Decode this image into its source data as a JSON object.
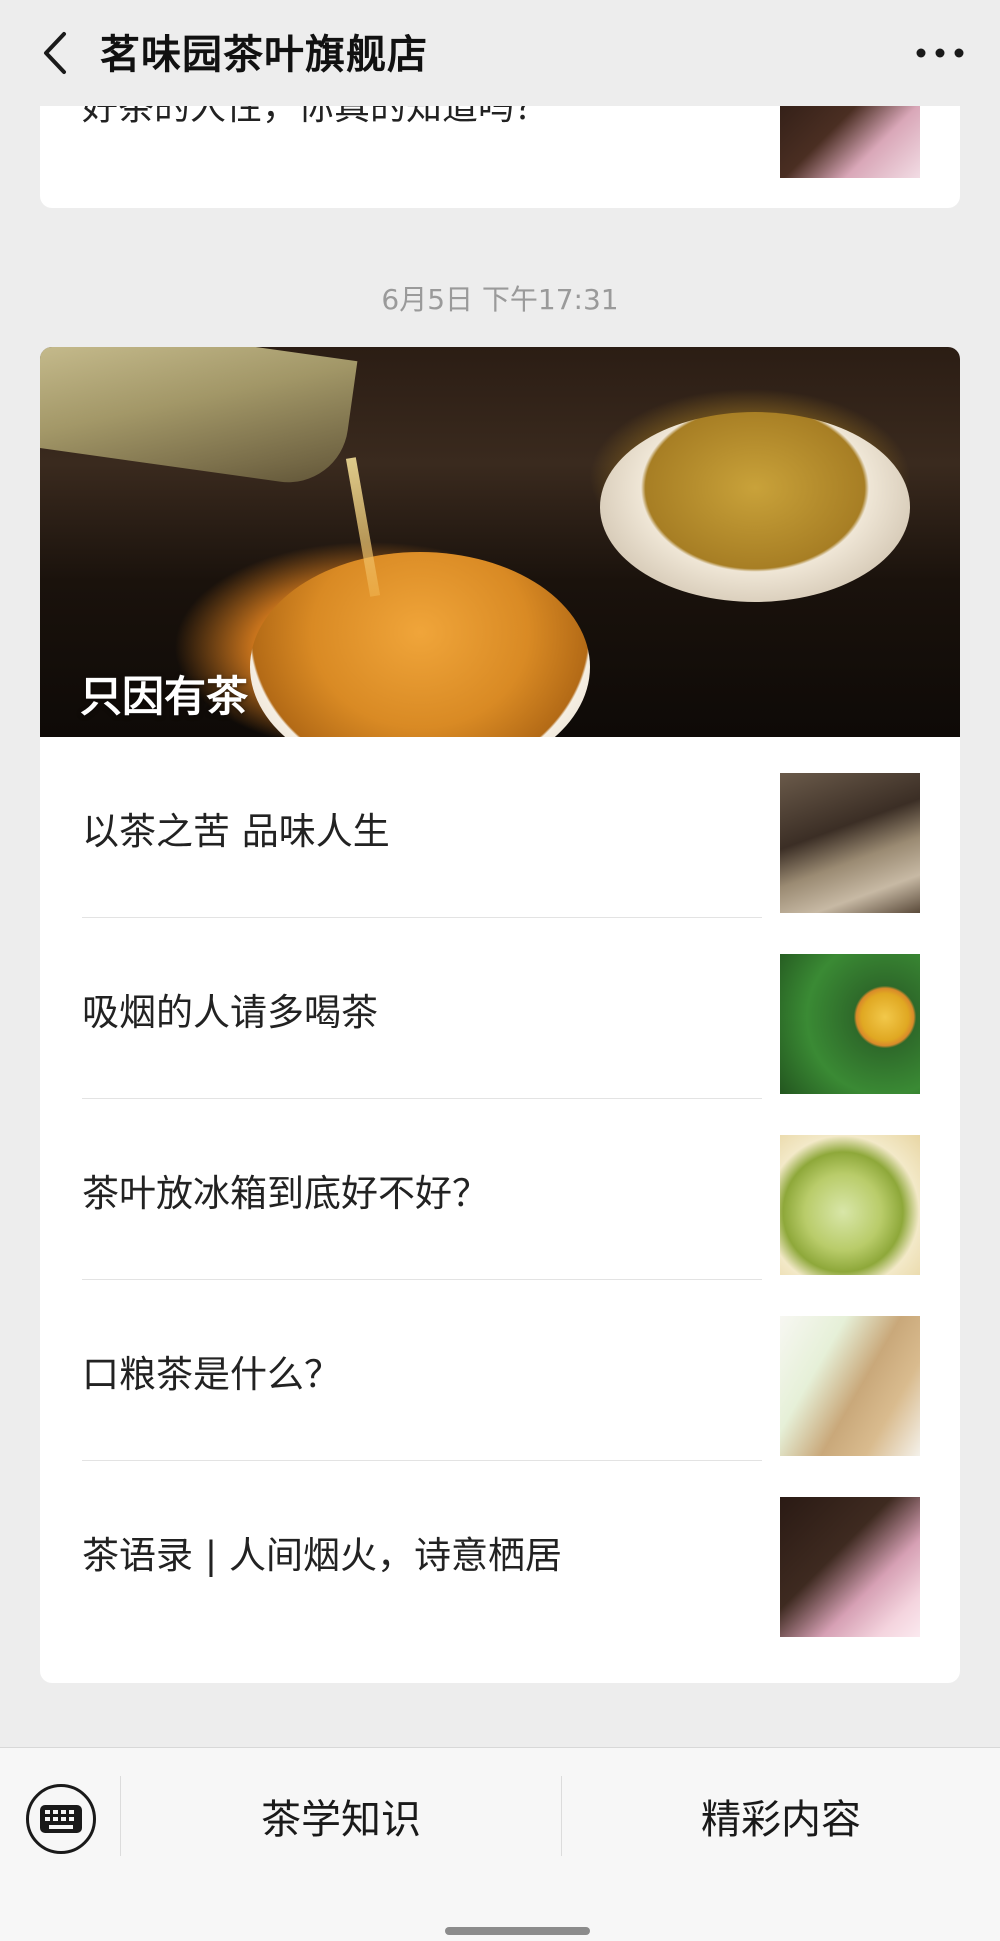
{
  "header": {
    "title": "茗味园茶叶旗舰店",
    "back_icon": "chevron-left-icon",
    "more_icon": "more-dots-icon"
  },
  "previous_article": {
    "title": "好茶的人性，你真的知道吗？"
  },
  "message": {
    "timestamp": "6月5日 下午17:31",
    "cover_title": "只因有茶",
    "items": [
      {
        "title": "以茶之苦   品味人生"
      },
      {
        "title": "吸烟的人请多喝茶"
      },
      {
        "title": "茶叶放冰箱到底好不好？"
      },
      {
        "title": "口粮茶是什么？"
      },
      {
        "title": "茶语录 | 人间烟火，诗意栖居"
      }
    ]
  },
  "bottom_menu": {
    "keyboard_icon": "keyboard-icon",
    "items": [
      {
        "label": "茶学知识"
      },
      {
        "label": "精彩内容"
      }
    ]
  }
}
